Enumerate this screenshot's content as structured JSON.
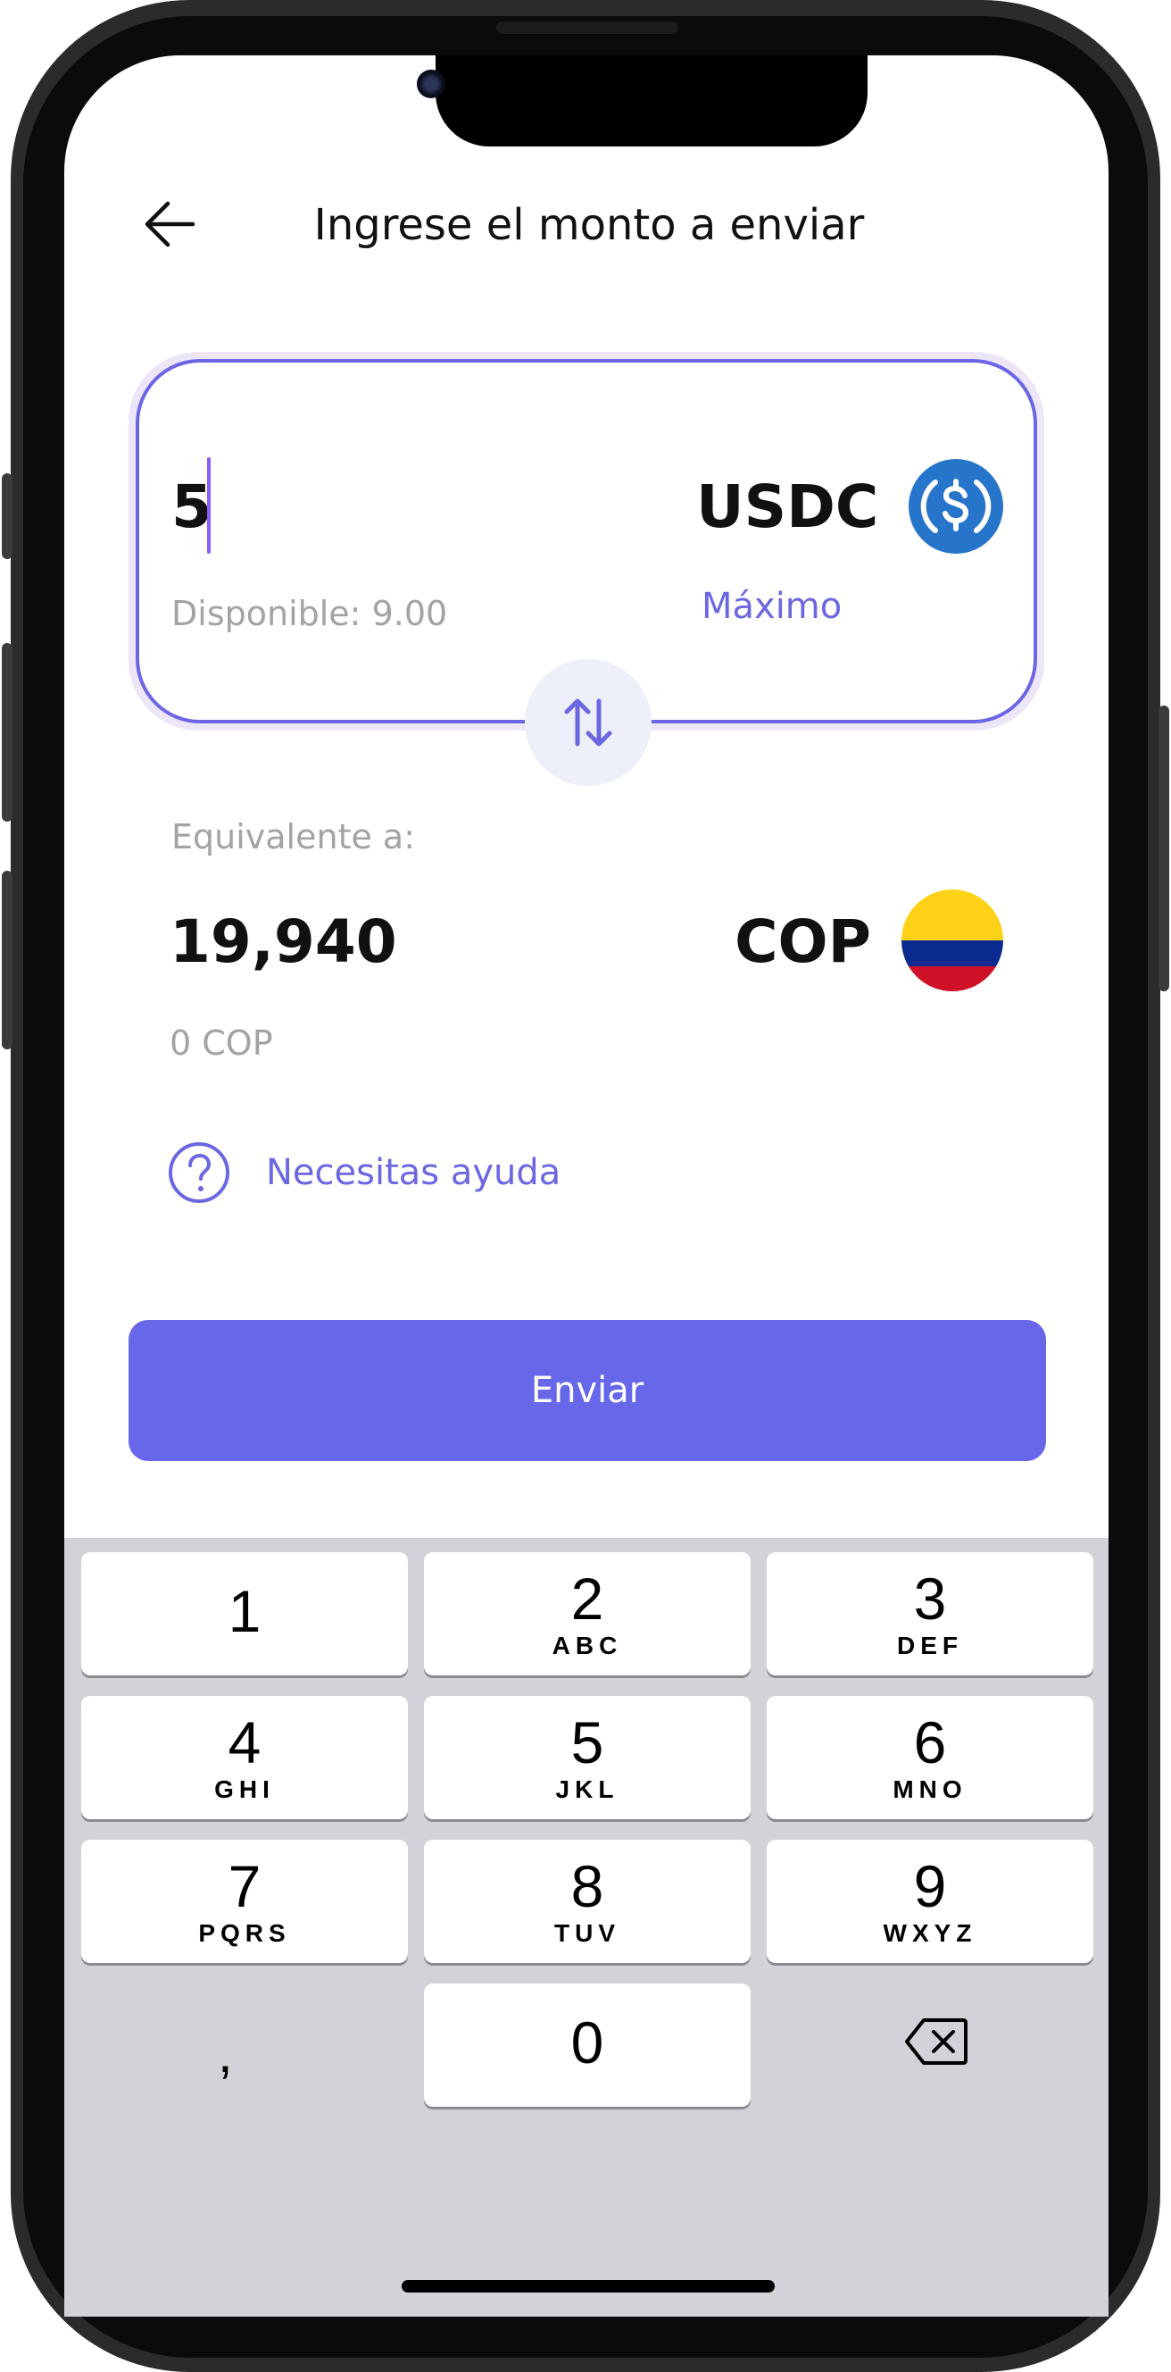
{
  "header": {
    "title": "Ingrese el monto a enviar",
    "back_icon": "arrow-left-icon"
  },
  "send_card": {
    "amount": "5",
    "currency": "USDC",
    "currency_icon": "usdc-coin-icon",
    "available": "Disponible: 9.00",
    "max_label": "Máximo",
    "swap_icon": "swap-arrows-icon"
  },
  "receive": {
    "label": "Equivalente a:",
    "amount": "19,940",
    "currency": "COP",
    "flag_icon": "colombia-flag-icon",
    "secondary_amount": "0 COP"
  },
  "help": {
    "label": "Necesitas ayuda",
    "icon": "question-circle-icon"
  },
  "send_button": {
    "label": "Enviar"
  },
  "keyboard": {
    "keys": [
      {
        "num": "1",
        "letters": ""
      },
      {
        "num": "2",
        "letters": "ABC"
      },
      {
        "num": "3",
        "letters": "DEF"
      },
      {
        "num": "4",
        "letters": "GHI"
      },
      {
        "num": "5",
        "letters": "JKL"
      },
      {
        "num": "6",
        "letters": "MNO"
      },
      {
        "num": "7",
        "letters": "PQRS"
      },
      {
        "num": "8",
        "letters": "TUV"
      },
      {
        "num": "9",
        "letters": "WXYZ"
      },
      {
        "num": "0",
        "letters": ""
      }
    ],
    "decimal": ",",
    "delete_icon": "backspace-icon"
  },
  "colors": {
    "accent": "#6668E9",
    "card_border": "#6C66E4",
    "usdc_blue": "#2775CA",
    "keyboard_bg": "#D1D3D9"
  }
}
